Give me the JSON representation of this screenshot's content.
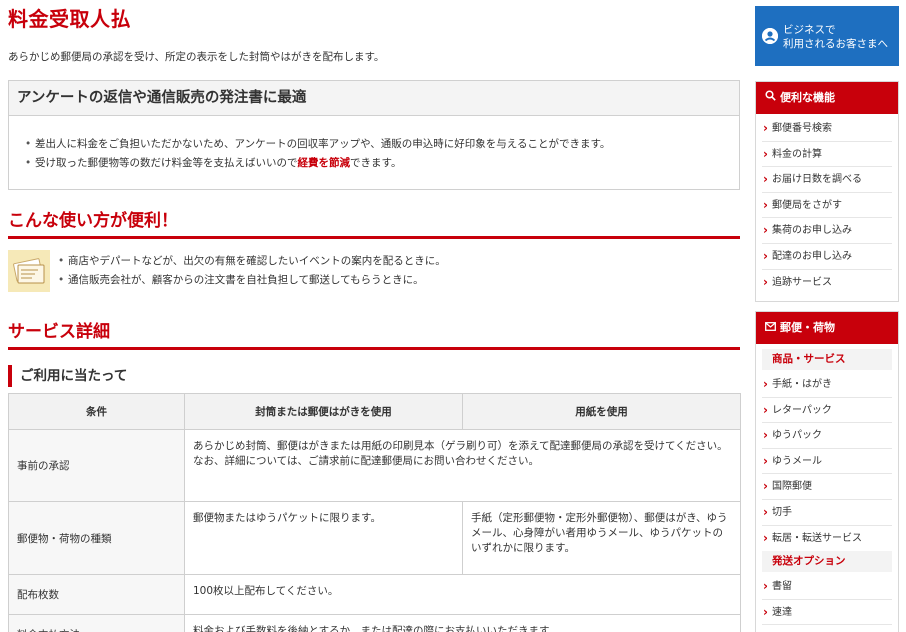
{
  "page": {
    "title": "料金受取人払",
    "lead": "あらかじめ郵便局の承認を受け、所定の表示をした封筒やはがきを配布します。"
  },
  "feature": {
    "heading": "アンケートの返信や通信販売の発注書に最適",
    "items": [
      {
        "text": "差出人に料金をご負担いただかないため、アンケートの回収率アップや、通販の申込時に好印象を与えることができます。"
      },
      {
        "before": "受け取った郵便物等の数だけ料金等を支払えばいいので",
        "emphasis": "経費を節減",
        "after": "できます。"
      }
    ]
  },
  "usage": {
    "heading": "こんな使い方が便利！",
    "illustration_icon": "envelope-letters-icon",
    "items": [
      "商店やデパートなどが、出欠の有無を確認したいイベントの案内を配るときに。",
      "通信販売会社が、顧客からの注文書を自社負担して郵送してもらうときに。"
    ]
  },
  "detail": {
    "heading": "サービス詳細",
    "subheading": "ご利用に当たって",
    "table": {
      "headers": [
        "条件",
        "封筒または郵便はがきを使用",
        "用紙を使用"
      ],
      "rows": [
        {
          "label": "事前の承認",
          "merged": "あらかじめ封筒、郵便はがきまたは用紙の印刷見本（ゲラ刷り可）を添えて配達郵便局の承認を受けてください。\nなお、詳細については、ご請求前に配達郵便局にお問い合わせください。"
        },
        {
          "label": "郵便物・荷物の種類",
          "col1": "郵便物またはゆうパケットに限ります。",
          "col2": "手紙（定形郵便物・定形外郵便物）、郵便はがき、ゆうメール、心身障がい者用ゆうメール、ゆうパケットのいずれかに限ります。"
        },
        {
          "label": "配布枚数",
          "merged": "100枚以上配布してください。"
        },
        {
          "label": "料金支払方法",
          "merged": "料金および手数料を後納とするか、または配達の際にお支払いいただきます。"
        }
      ]
    }
  },
  "sidebar": {
    "business_button": {
      "line1": "ビジネスで",
      "line2": "利用されるお客さまへ",
      "icon": "business-user-icon"
    },
    "tools": {
      "title": "便利な機能",
      "icon": "magnifier-icon",
      "items": [
        "郵便番号検索",
        "料金の計算",
        "お届け日数を調べる",
        "郵便局をさがす",
        "集荷のお申し込み",
        "配達のお申し込み",
        "追跡サービス"
      ]
    },
    "mail": {
      "title": "郵便・荷物",
      "icon": "envelope-icon",
      "category1": "商品・サービス",
      "items1": [
        "手紙・はがき",
        "レターパック",
        "ゆうパック",
        "ゆうメール",
        "国際郵便",
        "切手",
        "転居・転送サービス"
      ],
      "category2": "発送オプション",
      "items2": [
        "書留",
        "速達"
      ]
    }
  },
  "colors": {
    "accent": "#c8000b",
    "business_blue": "#1e6fc0",
    "table_header_bg": "#f2f2f2"
  }
}
